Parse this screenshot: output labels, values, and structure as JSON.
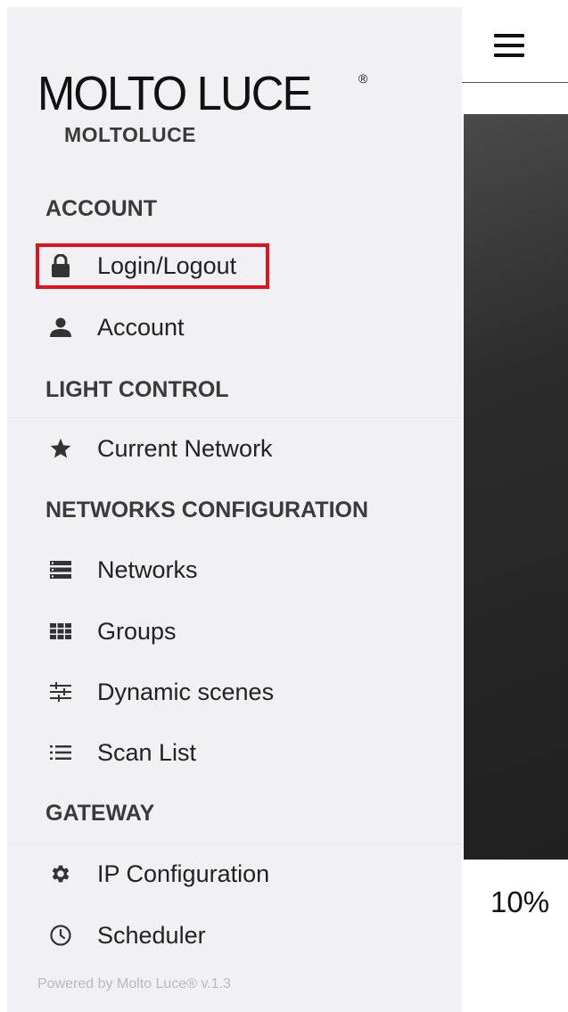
{
  "logo": {
    "text": "MOLTO LUCE",
    "registered": "®",
    "subtitle": "MOLTOLUCE"
  },
  "sections": {
    "account": "ACCOUNT",
    "light_control": "LIGHT CONTROL",
    "networks_configuration": "NETWORKS CONFIGURATION",
    "gateway": "GATEWAY"
  },
  "menu": {
    "login_logout": {
      "label": "Login/Logout",
      "icon": "lock-icon"
    },
    "account": {
      "label": "Account",
      "icon": "person-icon"
    },
    "current_network": {
      "label": "Current Network",
      "icon": "star-icon"
    },
    "networks": {
      "label": "Networks",
      "icon": "server-list-icon"
    },
    "groups": {
      "label": "Groups",
      "icon": "grid-icon"
    },
    "dynamic_scenes": {
      "label": "Dynamic scenes",
      "icon": "sliders-icon"
    },
    "scan_list": {
      "label": "Scan List",
      "icon": "list-icon"
    },
    "ip_configuration": {
      "label": "IP Configuration",
      "icon": "gear-icon"
    },
    "scheduler": {
      "label": "Scheduler",
      "icon": "clock-icon"
    }
  },
  "footer": {
    "text": "Powered by Molto Luce® v.1.3"
  },
  "main": {
    "level": "10%"
  },
  "colors": {
    "highlight": "#e0141c",
    "drawer_bg": "#f0f0f5",
    "panel_dark": "#252525"
  }
}
